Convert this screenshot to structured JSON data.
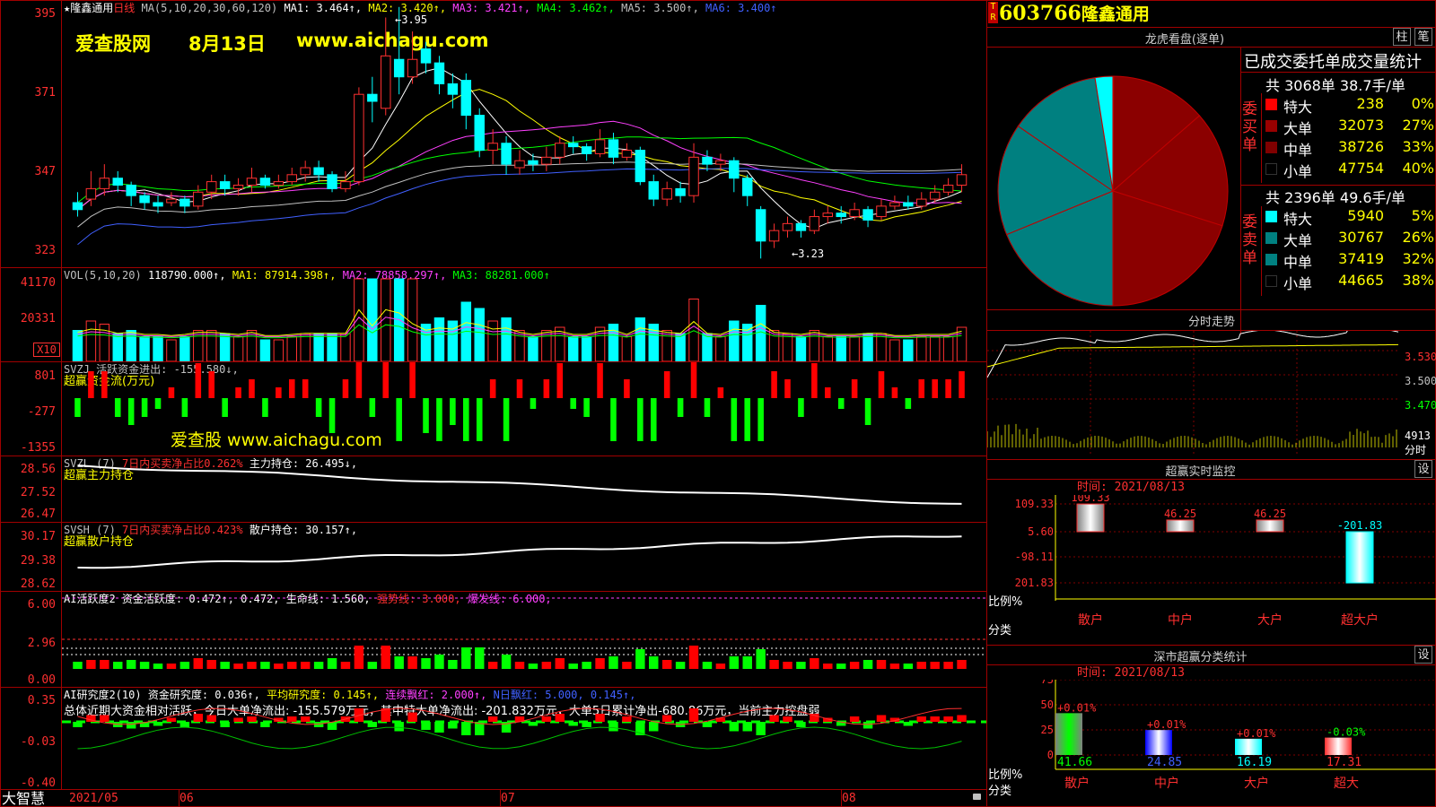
{
  "stock": {
    "code": "603766",
    "name": "隆鑫通用",
    "period": "日线",
    "badge_top": "T",
    "badge_bot": "R"
  },
  "watermark": {
    "site_name": "爱查股网",
    "date": "8月13日",
    "url": "www.aichagu.com",
    "url2": "爱查股 www.aichagu.com"
  },
  "main_chart": {
    "title": "★隆鑫通用",
    "ma_params": "MA(5,10,20,30,60,120)",
    "ma_items": [
      {
        "label": "MA1: 3.464↑,",
        "color": "#ffffff"
      },
      {
        "label": "MA2: 3.420↑,",
        "color": "#ffff00"
      },
      {
        "label": "MA3: 3.421↑,",
        "color": "#ff40ff"
      },
      {
        "label": "MA4: 3.462↑,",
        "color": "#00ff00"
      },
      {
        "label": "MA5: 3.500↑,",
        "color": "#c0c0c0"
      },
      {
        "label": "MA6: 3.400↑",
        "color": "#4060ff"
      }
    ],
    "y_ticks": [
      "395",
      "371",
      "347",
      "323"
    ],
    "high_label": "3.95",
    "low_label": "3.23"
  },
  "vol_panel": {
    "title": "VOL(5,10,20)",
    "value": "118790.000↑,",
    "ma1": "MA1: 87914.398↑,",
    "ma2": "MA2: 78858.297↑,",
    "ma3": "MA3: 88281.000↑",
    "y_ticks": [
      "41170",
      "20331"
    ],
    "unit": "X10"
  },
  "svzj_panel": {
    "title": "SVZJ  活跃资金进出: -155.580↓,",
    "subtitle": "超赢资金流(万元)",
    "y_ticks": [
      "801",
      "-277",
      "-1355"
    ]
  },
  "svzl_panel": {
    "prefix": "SVZL (7)",
    "ratio": "7日内买卖净占比0.262%",
    "holding": "主力持仓: 26.495↓,",
    "subtitle": "超赢主力持仓",
    "y_ticks": [
      "28.56",
      "27.52",
      "26.47"
    ]
  },
  "svsh_panel": {
    "prefix": "SVSH (7)",
    "ratio": "7日内买卖净占比0.423%",
    "holding": "散户持仓: 30.157↑,",
    "subtitle": "超赢散户持仓",
    "y_ticks": [
      "30.17",
      "29.38",
      "28.62"
    ]
  },
  "ai_active_panel": {
    "title": "AI活跃度2",
    "fund": "资金活跃度: 0.472↑, 0.472,",
    "life": "生命线: 1.560,",
    "strong": "强势线: 3.000,",
    "burst": "爆发线: 6.000,",
    "y_ticks": [
      "6.00",
      "2.96",
      "0.00"
    ]
  },
  "ai_research_panel": {
    "title": "AI研究度2(10)",
    "research": "资金研究度: 0.036↑,",
    "avg": "平均研究度: 0.145↑,",
    "streak": "连续飘红: 2.000↑,",
    "nday": "N日飘红: 5.000, 0.145↑,",
    "summary": "总体近期大资金相对活跃，今日大单净流出: -155.579万元，其中特大单净流出: -201.832万元，大单5日累计净出-680.86万元，当前主力控盘弱",
    "y_ticks": [
      "0.35",
      "-0.03",
      "-0.40"
    ]
  },
  "time_axis": {
    "labels": [
      "2021/05",
      "06",
      "07",
      "08"
    ],
    "brand": "大智慧"
  },
  "right_panel": {
    "dragon_title": "龙虎看盘(逐单)",
    "btn_zhu": "柱",
    "btn_bi": "笔",
    "stats_title": "已成交委托单成交量统计",
    "buy": {
      "label": "委买单",
      "total": "共 3068单 38.7手/单",
      "rows": [
        {
          "name": "特大",
          "value": "238",
          "pct": "0%",
          "color": "#ff0000"
        },
        {
          "name": "大单",
          "value": "32073",
          "pct": "27%",
          "color": "#990000"
        },
        {
          "name": "中单",
          "value": "38726",
          "pct": "33%",
          "color": "#800000"
        },
        {
          "name": "小单",
          "value": "47754",
          "pct": "40%",
          "color": "#000000"
        }
      ]
    },
    "sell": {
      "label": "委卖单",
      "total": "共 2396单 49.6手/单",
      "rows": [
        {
          "name": "特大",
          "value": "5940",
          "pct": "5%",
          "color": "#00ffff"
        },
        {
          "name": "大单",
          "value": "30767",
          "pct": "26%",
          "color": "#008080"
        },
        {
          "name": "中单",
          "value": "37419",
          "pct": "32%",
          "color": "#008080"
        },
        {
          "name": "小单",
          "value": "44665",
          "pct": "38%",
          "color": "#000000"
        }
      ]
    },
    "intraday_title": "分时走势",
    "intraday_ticks": [
      "3.530",
      "3.500",
      "3.470"
    ],
    "intraday_vol": "4913",
    "intraday_vol_unit": "分时",
    "monitor_title": "超赢实时监控",
    "monitor_btn": "设",
    "monitor_time": "时间: 2021/08/13",
    "monitor_ticks": [
      "109.33",
      "5.60",
      "-98.11",
      "-201.83"
    ],
    "monitor_ratio": "比例%",
    "monitor_cat": "分类",
    "monitor_bars": [
      {
        "label": "散户",
        "value": 109.33,
        "text": "109.33"
      },
      {
        "label": "中户",
        "value": 46.25,
        "text": "46.25"
      },
      {
        "label": "大户",
        "value": 46.25,
        "text": "46.25"
      },
      {
        "label": "超大户",
        "value": -201.83,
        "text": "-201.83"
      }
    ],
    "sz_title": "深市超赢分类统计",
    "sz_btn": "设",
    "sz_time": "时间: 2021/08/13",
    "sz_ticks": [
      "75",
      "50",
      "25",
      "0"
    ],
    "sz_ratio": "比例%",
    "sz_cat": "分类",
    "sz_bars": [
      {
        "label": "散户",
        "value": 41.66,
        "text": "41.66",
        "delta": "+0.01%"
      },
      {
        "label": "中户",
        "value": 24.85,
        "text": "24.85",
        "delta": "+0.01%"
      },
      {
        "label": "大户",
        "value": 16.19,
        "text": "16.19",
        "delta": "+0.01%"
      },
      {
        "label": "超大",
        "value": 17.31,
        "text": "17.31",
        "delta": "-0.03%"
      }
    ]
  },
  "chart_data": {
    "type": "candlestick",
    "x_labels": [
      "2021/05",
      "06",
      "07",
      "08"
    ],
    "ylim": [
      3.2,
      3.97
    ],
    "pie": [
      {
        "name": "特大(买)",
        "value": 238
      },
      {
        "name": "大单(买)",
        "value": 32073
      },
      {
        "name": "中单(买)",
        "value": 38726
      },
      {
        "name": "小单(买)",
        "value": 47754
      },
      {
        "name": "特大(卖)",
        "value": 5940
      },
      {
        "name": "大单(卖)",
        "value": 30767
      },
      {
        "name": "中单(卖)",
        "value": 37419
      },
      {
        "name": "小单(卖)",
        "value": 44665
      }
    ],
    "candles": [
      [
        3.39,
        3.37,
        3.42,
        3.35
      ],
      [
        3.4,
        3.43,
        3.48,
        3.38
      ],
      [
        3.43,
        3.46,
        3.5,
        3.41
      ],
      [
        3.46,
        3.44,
        3.48,
        3.42
      ],
      [
        3.44,
        3.41,
        3.45,
        3.38
      ],
      [
        3.41,
        3.39,
        3.42,
        3.37
      ],
      [
        3.39,
        3.38,
        3.41,
        3.36
      ],
      [
        3.39,
        3.4,
        3.42,
        3.38
      ],
      [
        3.4,
        3.38,
        3.41,
        3.36
      ],
      [
        3.38,
        3.42,
        3.44,
        3.37
      ],
      [
        3.42,
        3.45,
        3.47,
        3.4
      ],
      [
        3.45,
        3.43,
        3.47,
        3.41
      ],
      [
        3.43,
        3.44,
        3.46,
        3.41
      ],
      [
        3.44,
        3.46,
        3.49,
        3.42
      ],
      [
        3.46,
        3.44,
        3.47,
        3.43
      ],
      [
        3.44,
        3.45,
        3.47,
        3.43
      ],
      [
        3.45,
        3.47,
        3.49,
        3.44
      ],
      [
        3.47,
        3.49,
        3.51,
        3.45
      ],
      [
        3.49,
        3.47,
        3.51,
        3.45
      ],
      [
        3.47,
        3.43,
        3.48,
        3.42
      ],
      [
        3.43,
        3.45,
        3.48,
        3.42
      ],
      [
        3.45,
        3.7,
        3.72,
        3.44
      ],
      [
        3.7,
        3.68,
        3.75,
        3.62
      ],
      [
        3.66,
        3.81,
        3.92,
        3.64
      ],
      [
        3.8,
        3.75,
        3.95,
        3.7
      ],
      [
        3.75,
        3.8,
        3.88,
        3.73
      ],
      [
        3.83,
        3.79,
        3.85,
        3.76
      ],
      [
        3.79,
        3.73,
        3.81,
        3.7
      ],
      [
        3.73,
        3.7,
        3.76,
        3.66
      ],
      [
        3.74,
        3.64,
        3.76,
        3.6
      ],
      [
        3.64,
        3.54,
        3.66,
        3.52
      ],
      [
        3.54,
        3.56,
        3.6,
        3.5
      ],
      [
        3.56,
        3.5,
        3.58,
        3.47
      ],
      [
        3.49,
        3.51,
        3.54,
        3.47
      ],
      [
        3.51,
        3.5,
        3.53,
        3.48
      ],
      [
        3.5,
        3.52,
        3.55,
        3.48
      ],
      [
        3.52,
        3.56,
        3.58,
        3.5
      ],
      [
        3.56,
        3.55,
        3.58,
        3.53
      ],
      [
        3.55,
        3.53,
        3.56,
        3.51
      ],
      [
        3.53,
        3.57,
        3.6,
        3.52
      ],
      [
        3.57,
        3.52,
        3.59,
        3.5
      ],
      [
        3.52,
        3.54,
        3.56,
        3.51
      ],
      [
        3.54,
        3.45,
        3.55,
        3.44
      ],
      [
        3.45,
        3.4,
        3.47,
        3.38
      ],
      [
        3.4,
        3.43,
        3.45,
        3.38
      ],
      [
        3.43,
        3.41,
        3.45,
        3.39
      ],
      [
        3.41,
        3.52,
        3.56,
        3.39
      ],
      [
        3.52,
        3.5,
        3.54,
        3.48
      ],
      [
        3.5,
        3.51,
        3.53,
        3.48
      ],
      [
        3.51,
        3.46,
        3.52,
        3.42
      ],
      [
        3.46,
        3.41,
        3.47,
        3.38
      ],
      [
        3.37,
        3.28,
        3.38,
        3.23
      ],
      [
        3.28,
        3.31,
        3.33,
        3.26
      ],
      [
        3.31,
        3.33,
        3.35,
        3.29
      ],
      [
        3.33,
        3.31,
        3.34,
        3.29
      ],
      [
        3.31,
        3.35,
        3.37,
        3.3
      ],
      [
        3.35,
        3.36,
        3.38,
        3.33
      ],
      [
        3.36,
        3.35,
        3.38,
        3.33
      ],
      [
        3.35,
        3.37,
        3.39,
        3.34
      ],
      [
        3.37,
        3.34,
        3.38,
        3.32
      ],
      [
        3.35,
        3.38,
        3.4,
        3.34
      ],
      [
        3.38,
        3.39,
        3.41,
        3.37
      ],
      [
        3.39,
        3.38,
        3.41,
        3.37
      ],
      [
        3.38,
        3.4,
        3.42,
        3.37
      ],
      [
        3.4,
        3.42,
        3.44,
        3.39
      ],
      [
        3.42,
        3.44,
        3.46,
        3.41
      ],
      [
        3.44,
        3.47,
        3.5,
        3.42
      ]
    ]
  }
}
